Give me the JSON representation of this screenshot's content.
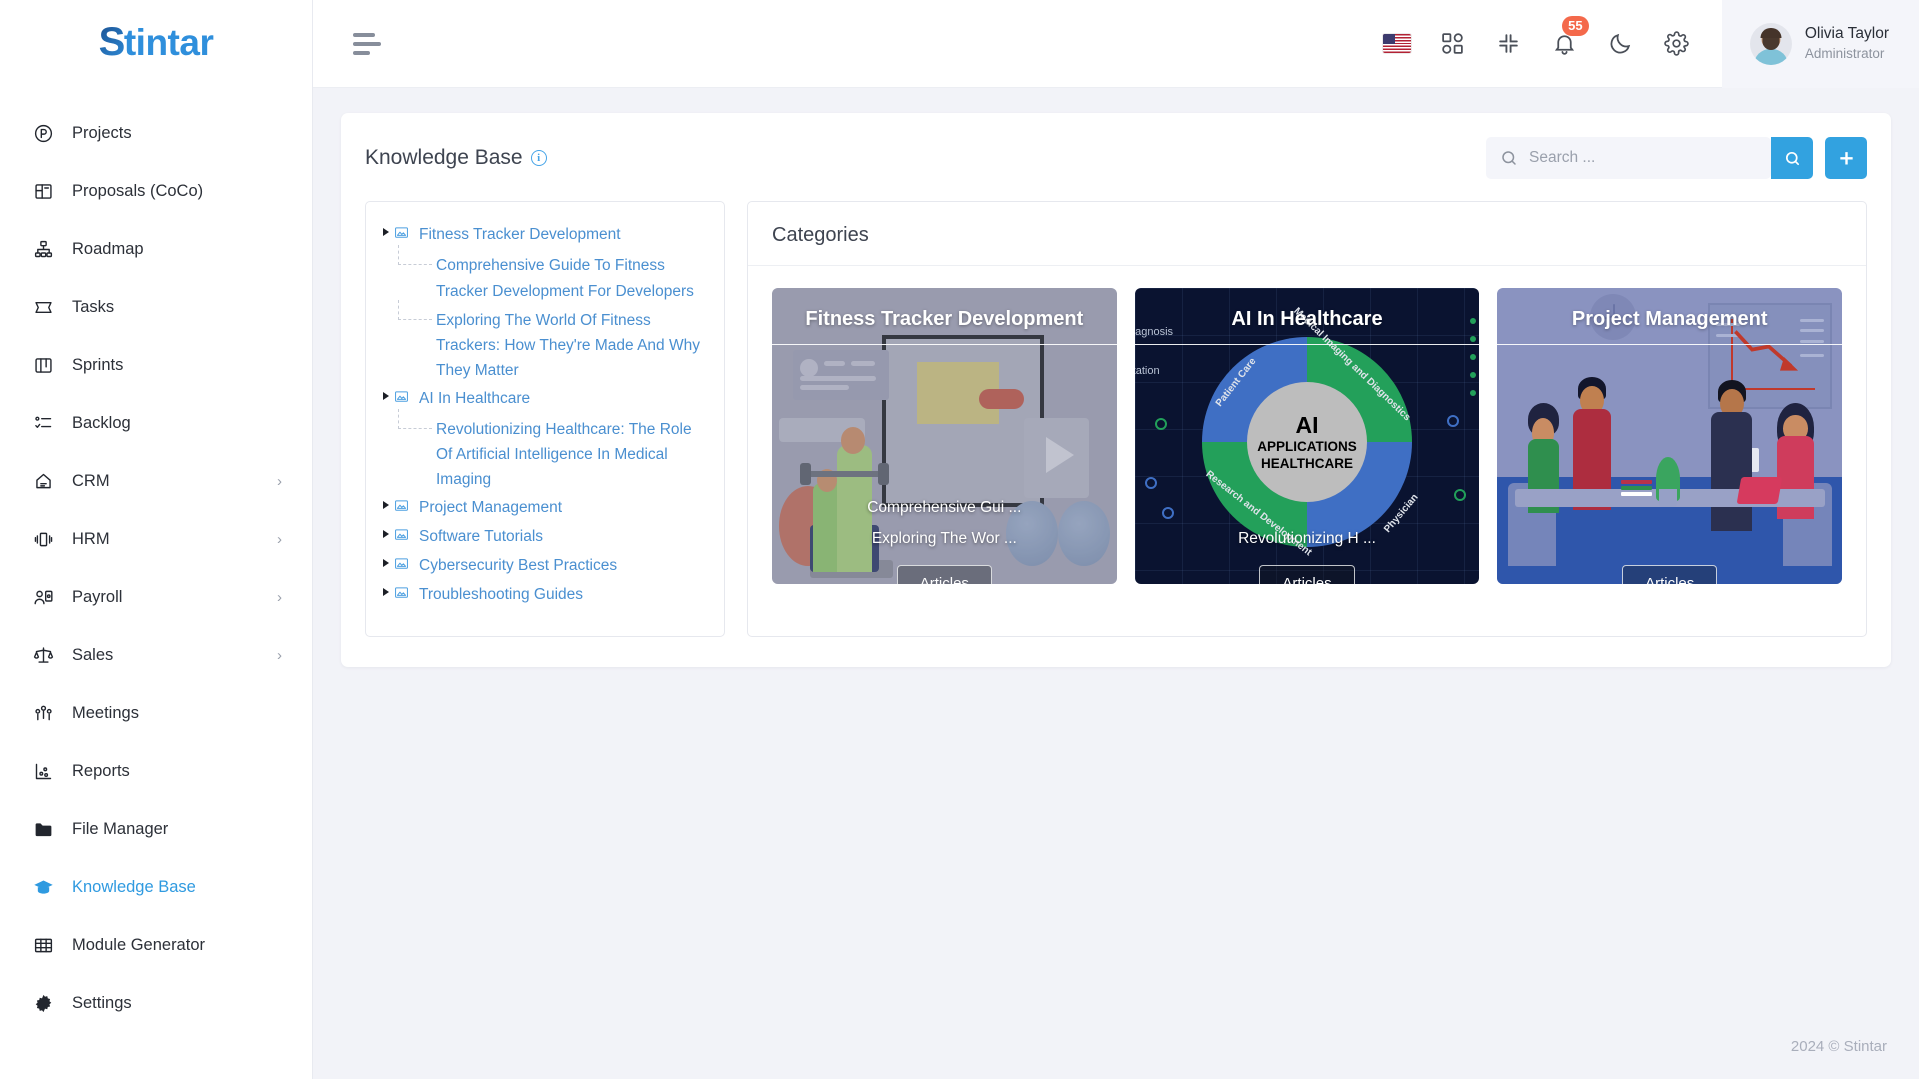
{
  "brand": {
    "s": "S",
    "rest": "tintar",
    "full": "Stintar"
  },
  "sidebar": {
    "items": [
      {
        "label": "Projects",
        "icon": "projects-icon",
        "has_chevron": false,
        "active": false
      },
      {
        "label": "Proposals (CoCo)",
        "icon": "proposals-icon",
        "has_chevron": false,
        "active": false
      },
      {
        "label": "Roadmap",
        "icon": "roadmap-icon",
        "has_chevron": false,
        "active": false
      },
      {
        "label": "Tasks",
        "icon": "tasks-icon",
        "has_chevron": false,
        "active": false
      },
      {
        "label": "Sprints",
        "icon": "sprints-icon",
        "has_chevron": false,
        "active": false
      },
      {
        "label": "Backlog",
        "icon": "backlog-icon",
        "has_chevron": false,
        "active": false
      },
      {
        "label": "CRM",
        "icon": "crm-icon",
        "has_chevron": true,
        "active": false
      },
      {
        "label": "HRM",
        "icon": "hrm-icon",
        "has_chevron": true,
        "active": false
      },
      {
        "label": "Payroll",
        "icon": "payroll-icon",
        "has_chevron": true,
        "active": false
      },
      {
        "label": "Sales",
        "icon": "sales-icon",
        "has_chevron": true,
        "active": false
      },
      {
        "label": "Meetings",
        "icon": "meetings-icon",
        "has_chevron": false,
        "active": false
      },
      {
        "label": "Reports",
        "icon": "reports-icon",
        "has_chevron": false,
        "active": false
      },
      {
        "label": "File Manager",
        "icon": "folder-icon",
        "has_chevron": false,
        "active": false
      },
      {
        "label": "Knowledge Base",
        "icon": "graduation-cap-icon",
        "has_chevron": false,
        "active": true
      },
      {
        "label": "Module Generator",
        "icon": "grid-table-icon",
        "has_chevron": false,
        "active": false
      },
      {
        "label": "Settings",
        "icon": "gear-icon",
        "has_chevron": false,
        "active": false
      }
    ],
    "chevron_glyph": "›"
  },
  "topbar": {
    "menu_toggle": "hamburger-icon",
    "language_flag": "us-flag-icon",
    "apps_icon": "apps-grid-icon",
    "compress_icon": "compress-icon",
    "notifications_icon": "bell-icon",
    "notification_count": "55",
    "dark_mode_icon": "moon-icon",
    "settings_icon": "gear-icon",
    "user": {
      "name": "Olivia Taylor",
      "role": "Administrator"
    }
  },
  "page": {
    "title": "Knowledge Base",
    "info_glyph": "i"
  },
  "search": {
    "placeholder": "Search ...",
    "value": "",
    "search_button_icon": "search-icon",
    "add_button_icon": "plus-icon"
  },
  "tree": {
    "nodes": [
      {
        "label": "Fitness Tracker Development",
        "children": [
          "Comprehensive Guide To Fitness Tracker Development For Developers",
          "Exploring The World Of Fitness Trackers: How They're Made And Why They Matter"
        ]
      },
      {
        "label": "AI In Healthcare",
        "children": [
          "Revolutionizing Healthcare: The Role Of Artificial Intelligence In Medical Imaging"
        ]
      },
      {
        "label": "Project Management",
        "children": []
      },
      {
        "label": "Software Tutorials",
        "children": []
      },
      {
        "label": "Cybersecurity Best Practices",
        "children": []
      },
      {
        "label": "Troubleshooting Guides",
        "children": []
      }
    ]
  },
  "categories": {
    "heading": "Categories",
    "cards": [
      {
        "title": "Fitness Tracker Development",
        "articles": [
          "Comprehensive Gui ...",
          "Exploring The Wor ..."
        ],
        "button": "Articles",
        "art": "fitness"
      },
      {
        "title": "AI In Healthcare",
        "articles": [
          "Revolutionizing H ..."
        ],
        "button": "Articles",
        "art": "ai",
        "art_labels": {
          "center_line1": "AI",
          "center_line2": "APPLICATIONS",
          "center_line3": "HEALTHCARE",
          "ring": [
            "Patient Care",
            "Medical Imaging and Diagnostics",
            "Research and Development",
            "Physician"
          ],
          "side": [
            "iagnosis",
            "tation"
          ]
        }
      },
      {
        "title": "Project Management",
        "articles": [],
        "button": "Articles",
        "art": "pm"
      }
    ]
  },
  "footer": {
    "copyright": "2024 © Stintar"
  },
  "colors": {
    "accent": "#32a2e0",
    "sidebar_active": "#2f9ae0",
    "badge": "#f4694b",
    "tree_link": "#4a8fd0",
    "page_bg": "#f2f3f8"
  }
}
